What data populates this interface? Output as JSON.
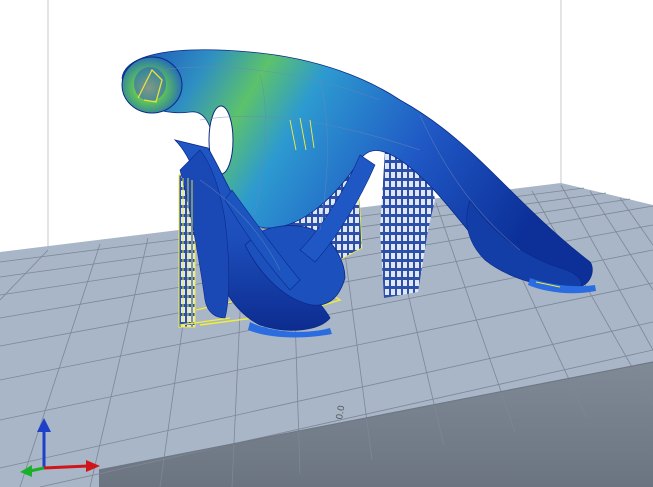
{
  "viewport": {
    "bed_label": "0.0",
    "colors": {
      "background": "#ffffff",
      "bed": "#a9b6c7",
      "bed_grid": "#7c8797",
      "bed_edge": "#6f7784",
      "part_dark": "#0a2a8a",
      "part_mid": "#1f57c4",
      "part_light": "#2d9ad0",
      "stress_green": "#4cc05c",
      "stress_yellow": "#e8e23a",
      "stress_orange": "#e0a020",
      "support": "#2c4fa8",
      "support_hatch": "#dfe7f7",
      "support_outline": "#f1ed3c",
      "axis_x": "#d0151a",
      "axis_y": "#1ab02a",
      "axis_z": "#1e3fc8"
    },
    "icons": [
      "axis-triad-icon"
    ]
  }
}
